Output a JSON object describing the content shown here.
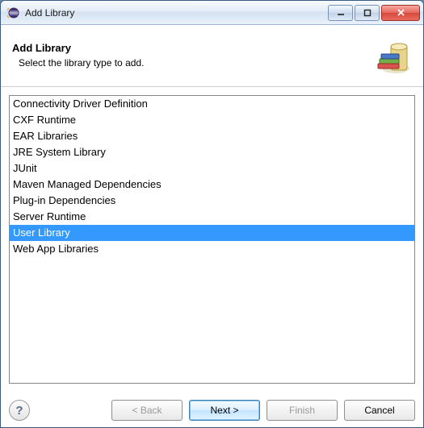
{
  "window": {
    "title": "Add Library"
  },
  "header": {
    "title": "Add Library",
    "subtitle": "Select the library type to add."
  },
  "list": {
    "items": [
      "Connectivity Driver Definition",
      "CXF Runtime",
      "EAR Libraries",
      "JRE System Library",
      "JUnit",
      "Maven Managed Dependencies",
      "Plug-in Dependencies",
      "Server Runtime",
      "User Library",
      "Web App Libraries"
    ],
    "selectedIndex": 8
  },
  "buttons": {
    "back": "< Back",
    "next": "Next >",
    "finish": "Finish",
    "cancel": "Cancel",
    "help": "?"
  }
}
